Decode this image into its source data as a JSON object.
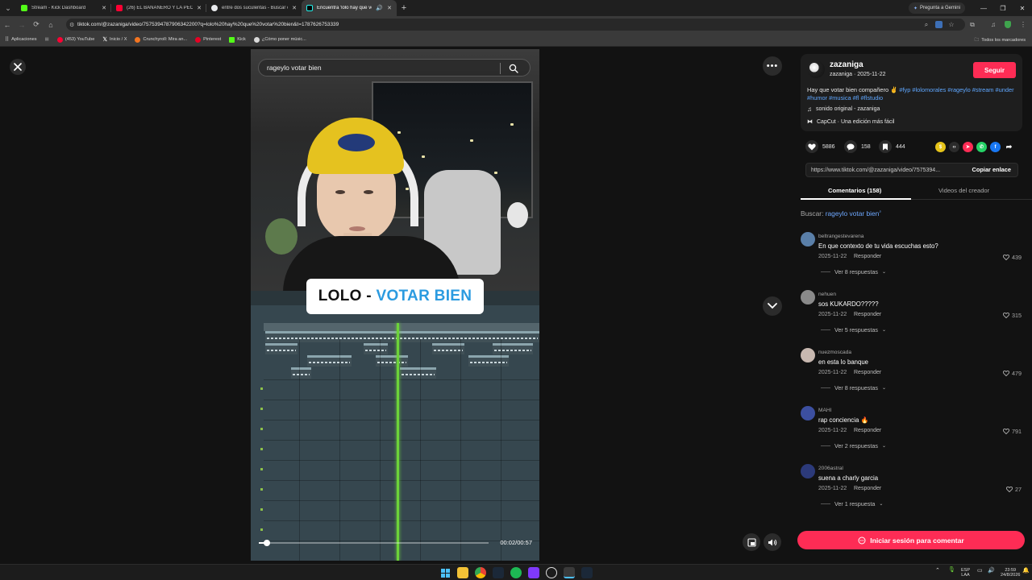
{
  "browser": {
    "tabs": [
      {
        "title": "Stream - Kick Dashboard",
        "color": "#53fc18"
      },
      {
        "title": "(26) EL BANANERO Y LA PEOR",
        "color": "#ff0033"
      },
      {
        "title": "entre dos suculentas - Buscar c",
        "color": "#e8eaed"
      },
      {
        "title": "Encuentra 'lolo hay que vot",
        "color": "#000000"
      }
    ],
    "gemini_label": "Pregunta a Gemini",
    "url": "tiktok.com/@zazaniga/video/7575394787906342200?q=lolo%20hay%20que%20votar%20bien&t=1787626753339",
    "bookmarks": [
      {
        "label": "Aplicaciones"
      },
      {
        "label": "(453) YouTube"
      },
      {
        "label": "Inicio / X"
      },
      {
        "label": "Crunchyroll: Mira an..."
      },
      {
        "label": "Pinterest"
      },
      {
        "label": "Kick"
      },
      {
        "label": "¿Cómo poner músic..."
      }
    ],
    "all_bookmarks_label": "Todos los marcadores"
  },
  "video": {
    "search_query": "rageylo votar bien",
    "caption_part1": "LOLO - ",
    "caption_part2": "VOTAR BIEN",
    "time": "00:02/00:57",
    "progress": 0.035
  },
  "post": {
    "author": "zazaniga",
    "author_date": "zazaniga · 2025-11-22",
    "follow_label": "Seguir",
    "description": "Hay que votar bien compañero ✌️",
    "hashtags": "#fyp #lolomorales #rageylo #stream #under #humor #musica #fl #flstudio",
    "sound": "sonido original - zazaniga",
    "capcut": "CapCut · Una edición más fácil",
    "likes": "5886",
    "comments_count": "158",
    "saves": "444",
    "link": "https://www.tiktok.com/@zazaniga/video/7575394...",
    "copy_label": "Copiar enlace"
  },
  "tabs": {
    "comments": "Comentarios (158)",
    "videos": "Videos del creador"
  },
  "search_context": {
    "label": "Buscar:",
    "query": "rageylo votar bien"
  },
  "comments": [
    {
      "user": "beltrangestevarena",
      "text": "En que contexto de tu vida escuchas esto?",
      "date": "2025-11-22",
      "reply": "Responder",
      "likes": "439",
      "more": "Ver 8 respuestas",
      "avatar_color": "#5a7fa8"
    },
    {
      "user": "nehuen",
      "text": "sos KUKARDO?????",
      "date": "2025-11-22",
      "reply": "Responder",
      "likes": "315",
      "more": "Ver 5 respuestas",
      "avatar_color": "#8a8a8a"
    },
    {
      "user": "nuezmoscada",
      "text": "en esta lo banque",
      "date": "2025-11-22",
      "reply": "Responder",
      "likes": "479",
      "more": "Ver 8 respuestas",
      "avatar_color": "#c8b8b0"
    },
    {
      "user": "MAHI",
      "text": "rap conciencia 🔥",
      "date": "2025-11-22",
      "reply": "Responder",
      "likes": "791",
      "more": "Ver 2 respuestas",
      "avatar_color": "#3c4fa0"
    },
    {
      "user": "2006astral",
      "text": "suena a charly garcia",
      "date": "2025-11-22",
      "reply": "Responder",
      "likes": "27",
      "more": "Ver 1 respuesta",
      "avatar_color": "#2c3a7a"
    }
  ],
  "login_label": "Iniciar sesión para comentar",
  "taskbar": {
    "lang": "ESP",
    "lang2": "LAA",
    "time": "23:59",
    "date": "24/8/2026"
  },
  "colors": {
    "accent": "#fe2c55",
    "link": "#5fa7ff",
    "playhead": "#6dd33a"
  }
}
